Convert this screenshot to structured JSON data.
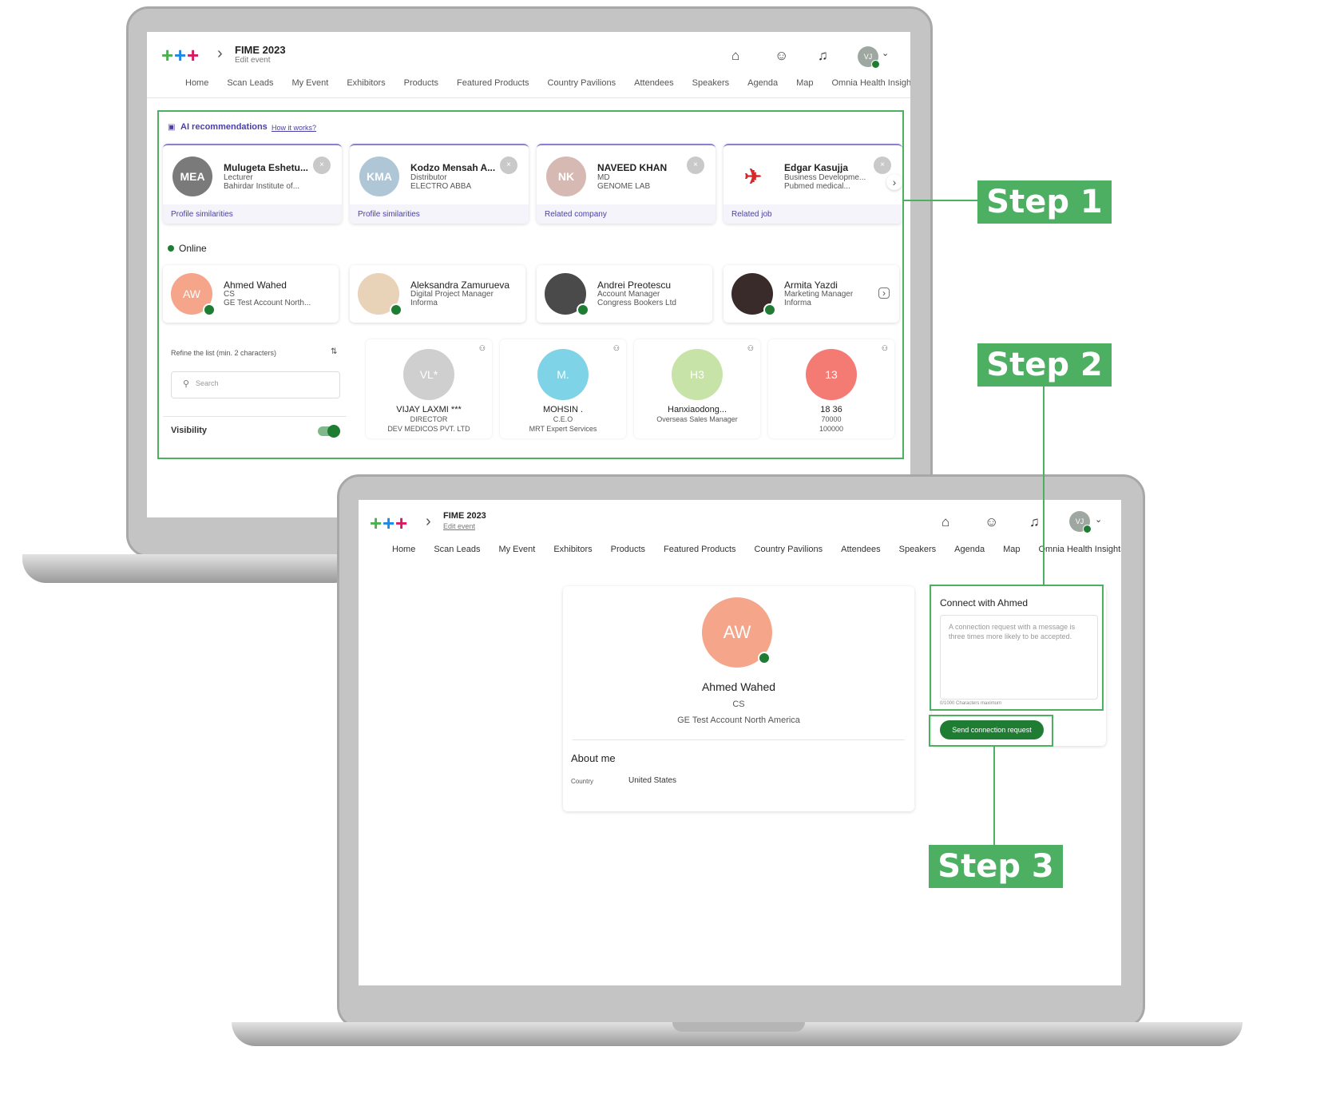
{
  "app": {
    "event_title": "FIME 2023",
    "edit_event": "Edit event",
    "user_initials": "VJ",
    "nav": [
      "Home",
      "Scan Leads",
      "My Event",
      "Exhibitors",
      "Products",
      "Featured Products",
      "Country Pavilions",
      "Attendees",
      "Speakers",
      "Agenda",
      "Map",
      "Omnia Health Insights"
    ]
  },
  "ai": {
    "title": "AI recommendations",
    "how": "How it works?",
    "cards": [
      {
        "initials": "MEA",
        "name": "Mulugeta Eshetu...",
        "role": "Lecturer",
        "company": "Bahirdar Institute of...",
        "reason": "Profile similarities",
        "color": "#7a7a7a"
      },
      {
        "initials": "KMA",
        "name": "Kodzo Mensah A...",
        "role": "Distributor",
        "company": "ELECTRO ABBA",
        "reason": "Profile similarities",
        "color": "#aec6d6"
      },
      {
        "initials": "NK",
        "name": "NAVEED KHAN",
        "role": "MD",
        "company": "GENOME LAB",
        "reason": "Related company",
        "color": "#d7b9b3"
      },
      {
        "initials": "",
        "name": "Edgar Kasujja",
        "role": "Business Developme...",
        "company": "Pubmed medical...",
        "reason": "Related job",
        "color": "#ffffff"
      }
    ]
  },
  "online": {
    "label": "Online",
    "people": [
      {
        "initials": "AW",
        "name": "Ahmed Wahed",
        "role": "CS",
        "company": "GE Test Account North...",
        "color": "#f4a58a"
      },
      {
        "initials": "",
        "name": "Aleksandra Zamurueva",
        "role": "Digital Project Manager",
        "company": "Informa",
        "color": "#e8d2b8"
      },
      {
        "initials": "",
        "name": "Andrei Preotescu",
        "role": "Account Manager",
        "company": "Congress Bookers Ltd",
        "color": "#4a4a4a"
      },
      {
        "initials": "",
        "name": "Armita Yazdi",
        "role": "Marketing Manager",
        "company": "Informa",
        "color": "#3a2b2b"
      }
    ]
  },
  "filter": {
    "refine": "Refine the list (min. 2 characters)",
    "search_placeholder": "Search",
    "visibility": "Visibility"
  },
  "grid": [
    {
      "initials": "VL*",
      "name": "VIJAY LAXMI ***",
      "line2": "DIRECTOR",
      "line3": "DEV MEDICOS PVT. LTD",
      "color": "#cfcfcf"
    },
    {
      "initials": "M.",
      "name": "MOHSIN .",
      "line2": "C.E.O",
      "line3": "MRT Expert Services",
      "color": "#7fd3e6"
    },
    {
      "initials": "H3",
      "name": "Hanxiaodong...",
      "line2": "Overseas Sales Manager",
      "line3": "",
      "color": "#c7e3a8"
    },
    {
      "initials": "13",
      "name": "18 36",
      "line2": "70000",
      "line3": "100000",
      "color": "#f47b73"
    }
  ],
  "profile": {
    "initials": "AW",
    "name": "Ahmed Wahed",
    "role": "CS",
    "company": "GE Test Account North America",
    "about": "About me",
    "country_label": "Country",
    "country_value": "United States"
  },
  "connect": {
    "title": "Connect with Ahmed",
    "placeholder": "A connection request with a message is three times more likely to be accepted.",
    "counter": "0/1000 Characters maximum",
    "button": "Send connection request"
  },
  "steps": [
    "Step 1",
    "Step 2",
    "Step 3"
  ],
  "colors": {
    "brand_green": "#1e7d32",
    "step_green": "#4caf62",
    "ai_purple": "#4a3fa8"
  }
}
